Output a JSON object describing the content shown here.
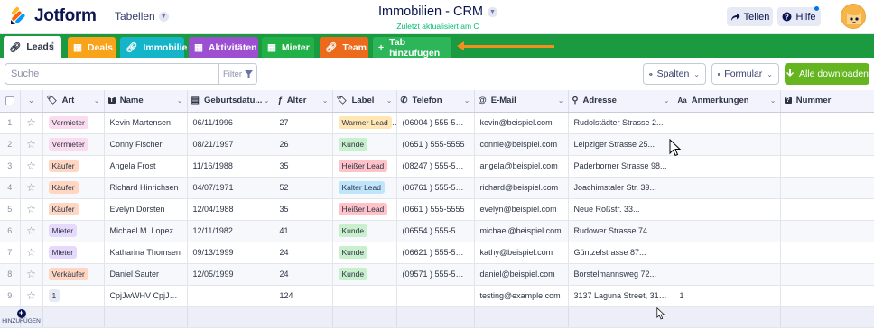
{
  "header": {
    "brand": "Jotform",
    "tables_menu": "Tabellen",
    "title": "Immobilien - CRM",
    "subtitle": "Zuletzt aktualisiert am C",
    "share_label": "Teilen",
    "help_label": "Hilfe"
  },
  "tabs": [
    {
      "label": "Leads",
      "color": "#ffffff",
      "icon": "link-icon"
    },
    {
      "label": "Deals",
      "color": "#f9a31a",
      "icon": "table-icon"
    },
    {
      "label": "Immobilie",
      "color": "#14b5c8",
      "icon": "link-icon"
    },
    {
      "label": "Aktivitäten",
      "color": "#9c4fd0",
      "icon": "table-icon"
    },
    {
      "label": "Mieter",
      "color": "#22b148",
      "icon": "table-icon"
    },
    {
      "label": "Team",
      "color": "#ec6a1b",
      "icon": "link-icon"
    },
    {
      "label": "Tab hinzufügen",
      "color": "#2db659",
      "icon": "plus-icon"
    }
  ],
  "toolbar": {
    "search_placeholder": "Suche",
    "filter_label": "Filter",
    "columns_label": "Spalten",
    "form_label": "Formular",
    "download_label": "Alle downloaden"
  },
  "columns": [
    {
      "label": "Art",
      "icon": "tag-icon"
    },
    {
      "label": "Name",
      "icon": "text-icon"
    },
    {
      "label": "Geburtsdatu...",
      "icon": "calendar-icon"
    },
    {
      "label": "Alter",
      "icon": "formula-icon"
    },
    {
      "label": "Label",
      "icon": "tag-icon"
    },
    {
      "label": "Telefon",
      "icon": "phone-icon"
    },
    {
      "label": "E-Mail",
      "icon": "at-icon"
    },
    {
      "label": "Adresse",
      "icon": "location-icon"
    },
    {
      "label": "Anmerkungen",
      "icon": "text-aa-icon"
    },
    {
      "label": "Nummer",
      "icon": "question-icon"
    }
  ],
  "rows": [
    {
      "num": "1",
      "art": "Vermieter",
      "art_color": "#fbdcef",
      "name": "Kevin Martensen",
      "dob": "06/11/1996",
      "age": "27",
      "label": "Warmer Lead",
      "label_color": "#ffe6b2",
      "phone": "(06004 ) 555-5555",
      "email": "kevin@beispiel.com",
      "address": "Rudolstädter Strasse 2...",
      "notes": "",
      "number": ""
    },
    {
      "num": "2",
      "art": "Vermieter",
      "art_color": "#fbdcef",
      "name": "Conny Fischer",
      "dob": "08/21/1997",
      "age": "26",
      "label": "Kunde",
      "label_color": "#c9f0cd",
      "phone": "(0651 ) 555-5555",
      "email": "connie@beispiel.com",
      "address": "Leipziger Strasse 25...",
      "notes": "",
      "number": ""
    },
    {
      "num": "3",
      "art": "Käufer",
      "art_color": "#ffd6c2",
      "name": "Angela Frost",
      "dob": "11/16/1988",
      "age": "35",
      "label": "Heißer Lead",
      "label_color": "#ffc2c8",
      "phone": "(08247 ) 555-5555",
      "email": "angela@beispiel.com",
      "address": "Paderborner Strasse 98...",
      "notes": "",
      "number": ""
    },
    {
      "num": "4",
      "art": "Käufer",
      "art_color": "#ffd6c2",
      "name": "Richard Hinrichsen",
      "dob": "04/07/1971",
      "age": "52",
      "label": "Kalter Lead",
      "label_color": "#bfe5fb",
      "phone": "(06761 ) 555-5555",
      "email": "richard@beispiel.com",
      "address": "Joachimstaler Str. 39...",
      "notes": "",
      "number": ""
    },
    {
      "num": "5",
      "art": "Käufer",
      "art_color": "#ffd6c2",
      "name": "Evelyn Dorsten",
      "dob": "12/04/1988",
      "age": "35",
      "label": "Heißer Lead",
      "label_color": "#ffc2c8",
      "phone": "(0661 ) 555-5555",
      "email": "evelyn@beispiel.com",
      "address": "Neue Roßstr. 33...",
      "notes": "",
      "number": ""
    },
    {
      "num": "6",
      "art": "Mieter",
      "art_color": "#e6d9fb",
      "name": "Michael M. Lopez",
      "dob": "12/11/1982",
      "age": "41",
      "label": "Kunde",
      "label_color": "#c9f0cd",
      "phone": "(06554 ) 555-5555",
      "email": "michael@beispiel.com",
      "address": "Rudower Strasse 74...",
      "notes": "",
      "number": ""
    },
    {
      "num": "7",
      "art": "Mieter",
      "art_color": "#e6d9fb",
      "name": "Katharina Thomsen",
      "dob": "09/13/1999",
      "age": "24",
      "label": "Kunde",
      "label_color": "#c9f0cd",
      "phone": "(06621 ) 555-5555",
      "email": "kathy@beispiel.com",
      "address": "Güntzelstrasse 87...",
      "notes": "",
      "number": ""
    },
    {
      "num": "8",
      "art": "Verkäufer",
      "art_color": "#ffd6c2",
      "name": "Daniel Sauter",
      "dob": "12/05/1999",
      "age": "24",
      "label": "Kunde",
      "label_color": "#c9f0cd",
      "phone": "(09571 ) 555-5555",
      "email": "daniel@beispiel.com",
      "address": "Borstelmannsweg 72...",
      "notes": "",
      "number": ""
    },
    {
      "num": "9",
      "art": "1",
      "art_color": "#e7e9f4",
      "name": "CpjJwWHV CpjJw...",
      "dob": "",
      "age": "124",
      "label": "",
      "label_color": "",
      "phone": "",
      "email": "testing@example.com",
      "address": "3137 Laguna Street, 3137 L...",
      "notes": "1",
      "number": ""
    }
  ],
  "add_row_label": "HINZUFÜGEN"
}
